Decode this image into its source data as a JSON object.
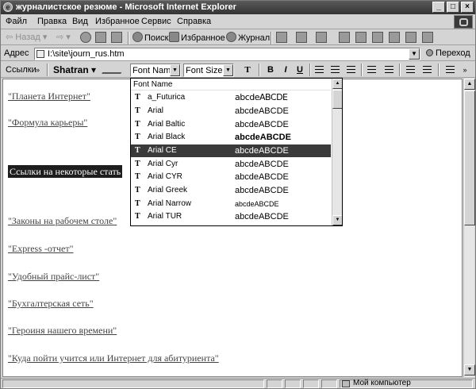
{
  "window": {
    "title": "журналистское резюме - Microsoft Internet Explorer",
    "controls": [
      "_",
      "□",
      "×"
    ]
  },
  "menu": [
    "Файл",
    "Правка",
    "Вид",
    "Избранное",
    "Сервис",
    "Справка"
  ],
  "toolbar": {
    "back": "Назад",
    "search": "Поиск",
    "favorites": "Избранное",
    "history": "Журнал"
  },
  "address": {
    "label": "Адрес",
    "value": "I:\\site\\journ_rus.htm",
    "go": "Переход"
  },
  "format_bar": {
    "links": "Ссылки",
    "links_chevron": "»",
    "plugin": "Shatran ▾",
    "font_name": "Font Name",
    "font_size": "Font Size",
    "bold": "B",
    "italic": "I",
    "underline": "U"
  },
  "font_dropdown": {
    "header": "Font Name",
    "selected": "Arial CE",
    "fonts": [
      {
        "name": "a_Futurica",
        "sample": "abcdeABCDE"
      },
      {
        "name": "Arial",
        "sample": "abcdeABCDE"
      },
      {
        "name": "Arial Baltic",
        "sample": "abcdeABCDE"
      },
      {
        "name": "Arial Black",
        "sample": "abcdeABCDE"
      },
      {
        "name": "Arial CE",
        "sample": "abcdeABCDE"
      },
      {
        "name": "Arial Cyr",
        "sample": "abcdeABCDE"
      },
      {
        "name": "Arial CYR",
        "sample": "abcdeABCDE"
      },
      {
        "name": "Arial Greek",
        "sample": "abcdeABCDE"
      },
      {
        "name": "Arial Narrow",
        "sample": "abcdeABCDE"
      },
      {
        "name": "Arial TUR",
        "sample": "abcdeABCDE"
      }
    ]
  },
  "page": {
    "links_top": [
      "\"Планета Интернет\"",
      "\"Формула карьеры\""
    ],
    "heading": "Ссылки на некоторые стать",
    "links_bottom": [
      "\"Законы на рабочем столе\"",
      "\"Express -отчет\"",
      "\"Удобный прайс-лист\"",
      "\"Бухгалтерская сеть\"",
      "\"Героиня нашего времени\"",
      "\"Куда пойти учится или Интернет для абитуриента\""
    ]
  },
  "status": {
    "zone": "Мой компьютер"
  },
  "icons": {
    "tt": "T",
    "up_arrow": "▲",
    "down_arrow": "▼"
  }
}
